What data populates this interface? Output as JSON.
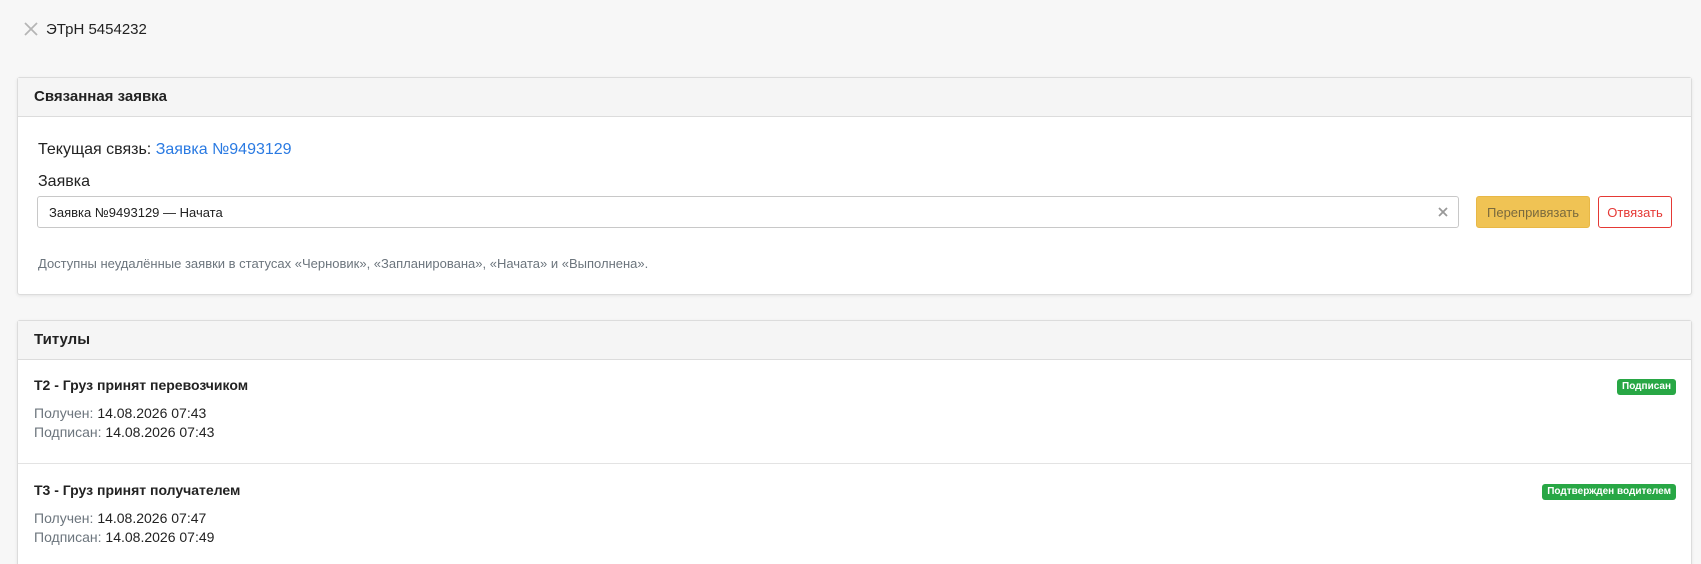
{
  "header": {
    "title": "ЭТрН 5454232",
    "close_icon": "close-icon"
  },
  "linked_card": {
    "title": "Связанная заявка",
    "current_link_label": "Текущая связь:",
    "current_link_value": "Заявка №9493129",
    "field_label": "Заявка",
    "select_value": "Заявка №9493129 — Начата",
    "rebind_label": "Перепривязать",
    "unbind_label": "Отвязать",
    "hint": "Доступны неудалённые заявки в статусах «Черновик», «Запланирована», «Начата» и «Выполнена»."
  },
  "titles_card": {
    "title": "Титулы",
    "items": [
      {
        "name": "Т2 - Груз принят перевозчиком",
        "received_label": "Получен:",
        "received_value": "14.08.2026 07:43",
        "signed_label": "Подписан:",
        "signed_value": "14.08.2026 07:43",
        "badge": "Подписан"
      },
      {
        "name": "Т3 - Груз принят получателем",
        "received_label": "Получен:",
        "received_value": "14.08.2026 07:47",
        "signed_label": "Подписан:",
        "signed_value": "14.08.2026 07:49",
        "badge": "Подтвержден водителем"
      }
    ]
  },
  "colors": {
    "link": "#2a7ae2",
    "warning": "#f0c354",
    "danger": "#e53935",
    "success": "#28a745"
  }
}
